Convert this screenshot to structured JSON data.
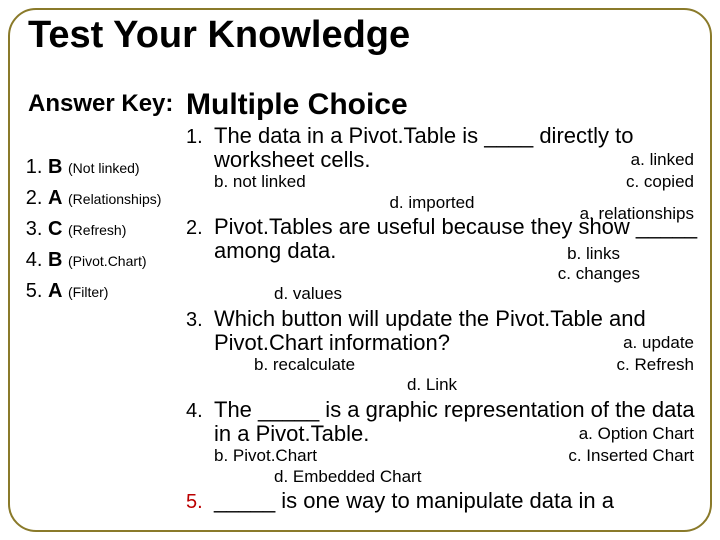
{
  "title": "Test Your Knowledge",
  "key": {
    "heading": "Answer Key:",
    "items": [
      {
        "letter": "B",
        "note": "(Not linked)"
      },
      {
        "letter": "A",
        "note": "(Relationships)"
      },
      {
        "letter": "C",
        "note": "(Refresh)"
      },
      {
        "letter": "B",
        "note": "(Pivot.Chart)"
      },
      {
        "letter": "A",
        "note": "(Filter)"
      }
    ]
  },
  "mc": {
    "heading": "Multiple Choice",
    "questions": [
      {
        "num": "1.",
        "stem": "The data in a Pivot.Table is ____ directly to worksheet cells.",
        "a": "a. linked",
        "b": "b. not linked",
        "c": "c. copied",
        "d": "d. imported"
      },
      {
        "num": "2.",
        "stem": "Pivot.Tables are useful because they show _____ among data.",
        "a": "a. relationships",
        "b": "b. links",
        "c": "c. changes",
        "d": "d. values"
      },
      {
        "num": "3.",
        "stem": "Which button will update the Pivot.Table and Pivot.Chart information?",
        "a": "a. update",
        "b": "b. recalculate",
        "c": "c. Refresh",
        "d": "d. Link"
      },
      {
        "num": "4.",
        "stem": "The _____ is a graphic representation of the data in a Pivot.Table.",
        "a": "a. Option Chart",
        "b": "b. Pivot.Chart",
        "c": "c. Inserted Chart",
        "d": "d. Embedded Chart"
      },
      {
        "num": "5.",
        "stem": "_____ is one way to manipulate data in a",
        "a": "",
        "b": "",
        "c": "",
        "d": ""
      }
    ]
  }
}
